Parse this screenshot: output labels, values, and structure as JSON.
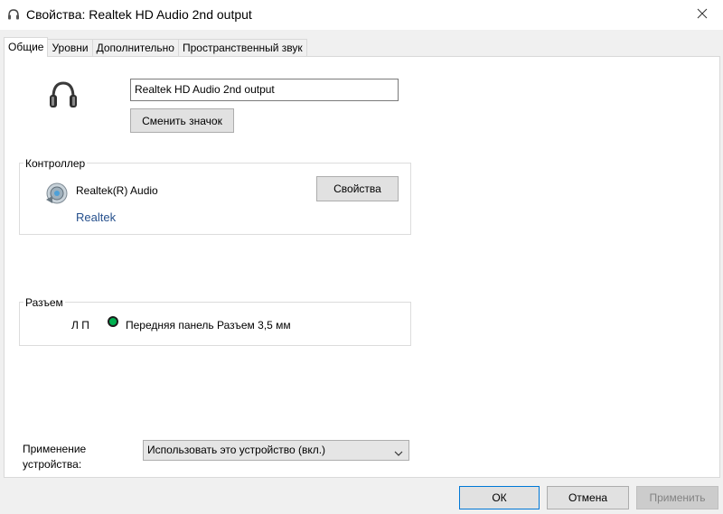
{
  "window": {
    "title": "Свойства: Realtek HD Audio 2nd output",
    "icon": "headphones-icon",
    "close_icon": "close-icon"
  },
  "tabs": [
    {
      "label": "Общие",
      "active": true
    },
    {
      "label": "Уровни",
      "active": false
    },
    {
      "label": "Дополнительно",
      "active": false
    },
    {
      "label": "Пространственный звук",
      "active": false
    }
  ],
  "general": {
    "device_name_value": "Realtek HD Audio 2nd output",
    "change_icon_label": "Сменить значок",
    "controller": {
      "group_label": "Контроллер",
      "name": "Realtek(R) Audio",
      "vendor": "Realtek",
      "properties_label": "Свойства"
    },
    "jack": {
      "group_label": "Разъем",
      "channels": "Л П",
      "description": "Передняя панель Разъем 3,5 мм",
      "color": "#00b050"
    },
    "usage": {
      "label_line1": "Применение",
      "label_line2": "устройства:",
      "selected": "Использовать это устройство (вкл.)"
    }
  },
  "footer": {
    "ok_label": "ОК",
    "cancel_label": "Отмена",
    "apply_label": "Применить"
  }
}
